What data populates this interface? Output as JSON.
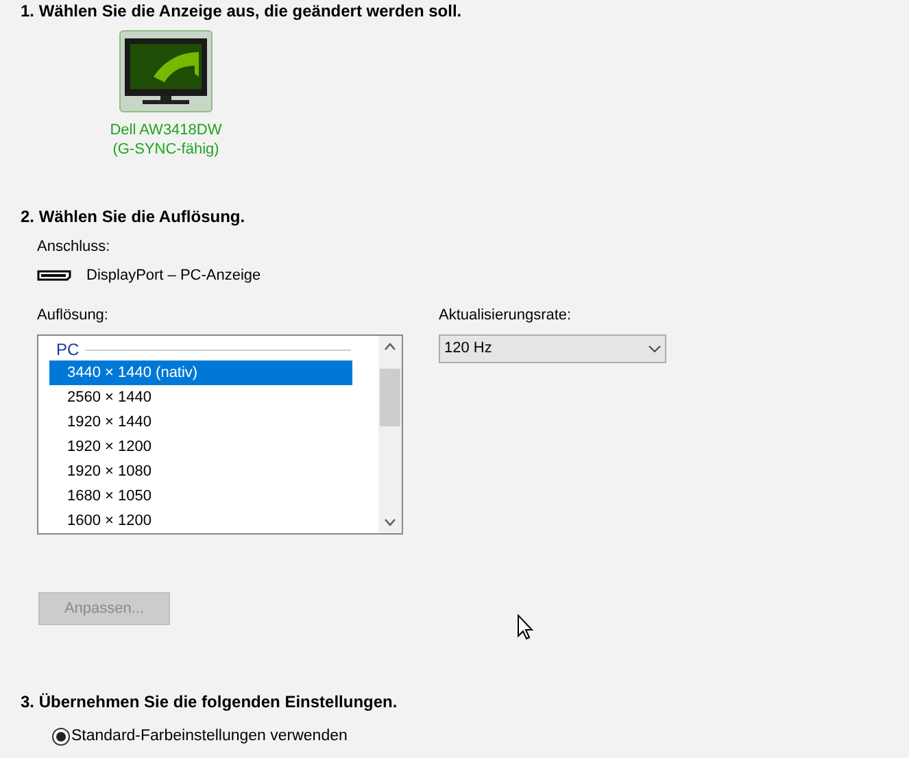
{
  "section_1": {
    "heading": "1. Wählen Sie die Anzeige aus, die geändert werden soll.",
    "displays": [
      {
        "name": "Dell AW3418DW",
        "subtitle": "(G-SYNC-fähig)",
        "selected": true
      }
    ]
  },
  "section_2": {
    "heading": "2. Wählen Sie die Auflösung.",
    "connection_label": "Anschluss:",
    "connection": "DisplayPort – PC-Anzeige",
    "resolution_label": "Auflösung:",
    "resolution_group": "PC",
    "resolutions": [
      {
        "label": "3440 × 1440 (nativ)",
        "selected": true
      },
      {
        "label": "2560 × 1440",
        "selected": false
      },
      {
        "label": "1920 × 1440",
        "selected": false
      },
      {
        "label": "1920 × 1200",
        "selected": false
      },
      {
        "label": "1920 × 1080",
        "selected": false
      },
      {
        "label": "1680 × 1050",
        "selected": false
      },
      {
        "label": "1600 × 1200",
        "selected": false
      }
    ],
    "refresh_label": "Aktualisierungsrate:",
    "refresh_value": "120 Hz",
    "customize_button": {
      "label": "Anpassen...",
      "disabled": true
    }
  },
  "section_3": {
    "heading": "3. Übernehmen Sie die folgenden Einstellungen.",
    "options": [
      {
        "label": "Standard-Farbeinstellungen verwenden",
        "selected": true
      }
    ]
  }
}
